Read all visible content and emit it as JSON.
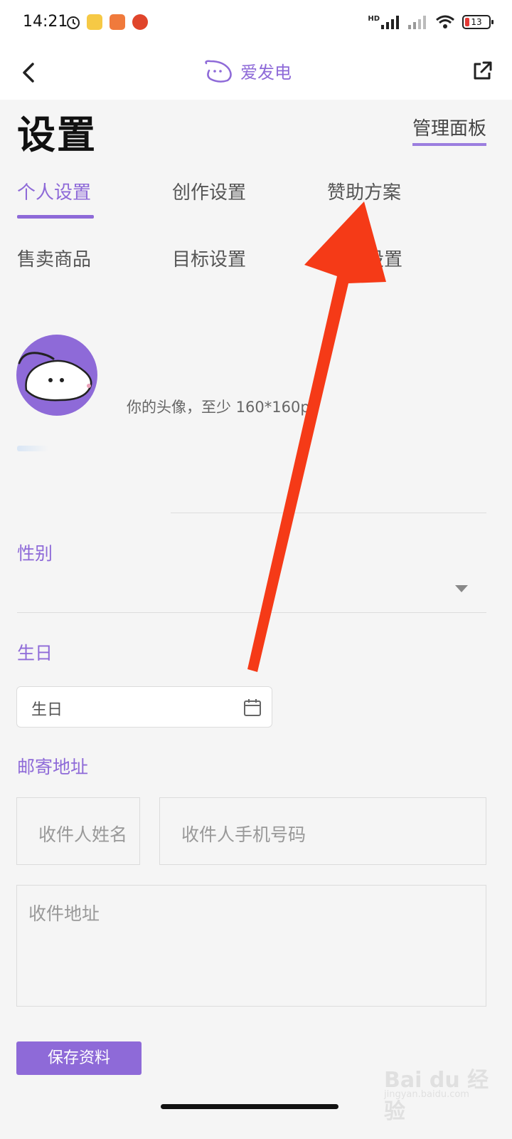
{
  "status_bar": {
    "time": "14:21",
    "hd_label": "HD",
    "battery_level": "13",
    "battery_color": "#e53935"
  },
  "nav": {
    "title": "爱发电",
    "back_icon": "chevron-left-icon",
    "share_icon": "external-link-icon",
    "accent_color": "#8e6ad8"
  },
  "page": {
    "title": "设置",
    "manage_link": "管理面板"
  },
  "tabs": [
    {
      "label": "个人设置",
      "active": true
    },
    {
      "label": "创作设置",
      "active": false
    },
    {
      "label": "赞助方案",
      "active": false
    },
    {
      "label": "售卖商品",
      "active": false
    },
    {
      "label": "目标设置",
      "active": false
    },
    {
      "label": "设置",
      "active": false
    }
  ],
  "profile": {
    "avatar_hint": "你的头像，至少 160*160px"
  },
  "gender": {
    "label": "性别",
    "value": ""
  },
  "birthday": {
    "label": "生日",
    "placeholder": "生日"
  },
  "address": {
    "label": "邮寄地址",
    "name_placeholder": "收件人姓名",
    "phone_placeholder": "收件人手机号码",
    "address_placeholder": "收件地址"
  },
  "actions": {
    "save_label": "保存资料"
  },
  "watermark": {
    "brand": "Bai du 经验",
    "url": "jingyan.baidu.com"
  }
}
